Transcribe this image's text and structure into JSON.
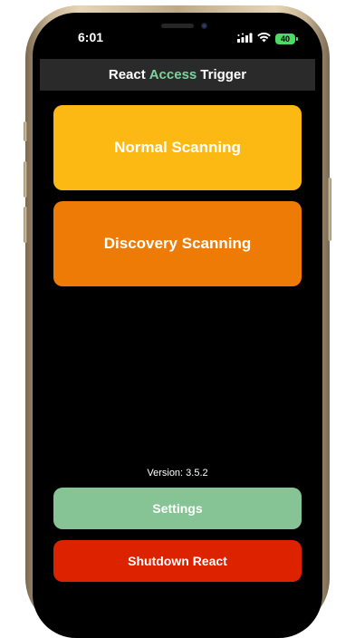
{
  "status_bar": {
    "time": "6:01",
    "battery": "40"
  },
  "header": {
    "title_part1": "React",
    "title_accent": "Access",
    "title_part2": "Trigger"
  },
  "buttons": {
    "normal_scanning": "Normal Scanning",
    "discovery_scanning": "Discovery Scanning",
    "settings": "Settings",
    "shutdown": "Shutdown React"
  },
  "version_text": "Version: 3.5.2",
  "colors": {
    "normal": "#fdb913",
    "discovery": "#ee7b06",
    "settings": "#86c495",
    "shutdown": "#dd2200",
    "accent": "#7ed39a"
  },
  "icons": [
    "signal-icon",
    "wifi-icon",
    "battery-icon"
  ]
}
